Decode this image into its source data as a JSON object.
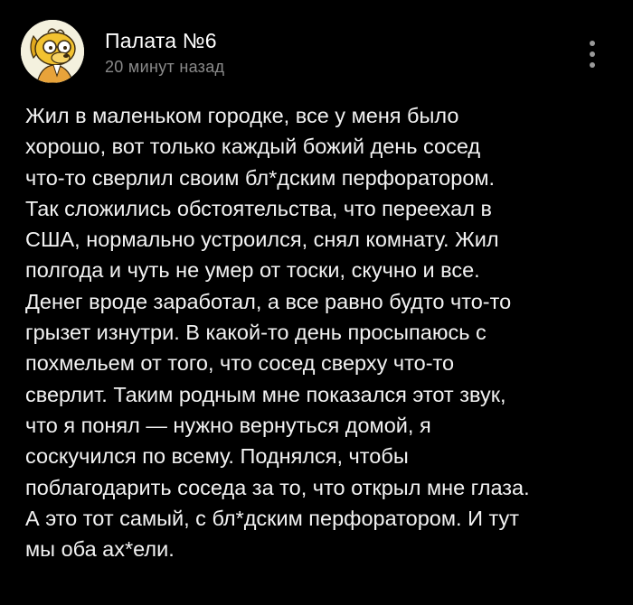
{
  "post": {
    "author": "Палата №6",
    "timestamp": "20 минут назад",
    "avatar_icon": "cartoon-dog-avatar",
    "more_icon": "vertical-dots-icon",
    "text": "Жил в маленьком городке, все у меня было\nхорошо, вот только каждый божий день сосед\nчто-то сверлил своим бл*дским перфоратором.\nТак сложились обстоятельства, что переехал в\nСША, нормально устроился, снял комнату. Жил\nполгода и чуть не умер от тоски, скучно и все.\nДенег вроде заработал, а все равно будто что-то\nгрызет изнутри. В какой-то день просыпаюсь с\nпохмельем от того, что сосед сверху что-то\nсверлит. Таким родным мне показался этот звук,\nчто я понял — нужно вернуться домой, я\nсоскучился по всему. Поднялся, чтобы\nпоблагодарить соседа за то, что открыл мне глаза.\nА это тот самый, с бл*дским перфоратором. И тут\nмы оба ах*ели."
  },
  "colors": {
    "background": "#000000",
    "text": "#f2f2f2",
    "muted": "#8a8a8a",
    "avatar_bg": "#f4f1de",
    "avatar_dog": "#f2c230"
  }
}
